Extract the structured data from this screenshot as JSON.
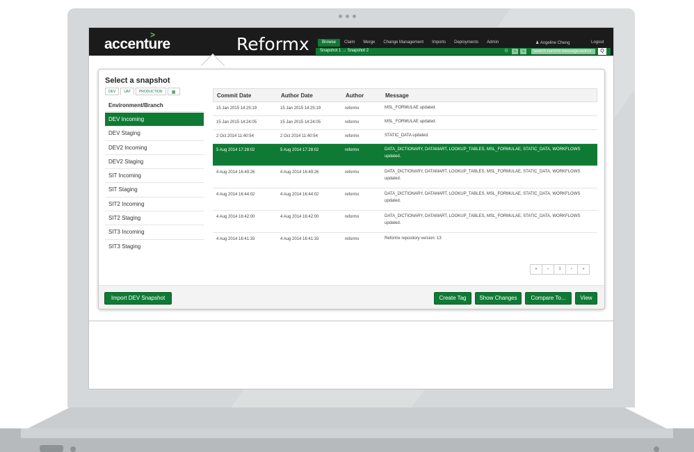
{
  "app": {
    "company": "accenture",
    "company_mark": ">",
    "product": "Reformx"
  },
  "nav": {
    "items": [
      "Browse",
      "Claim",
      "Merge",
      "Change Management",
      "Imports",
      "Deployments",
      "Admin"
    ],
    "user": "Angeline Cheng",
    "logout": "Logout"
  },
  "breadcrumb": {
    "text": "Snapshot 1 → Snapshot 2"
  },
  "search": {
    "placeholder": "Search commit message/author",
    "prev": "«",
    "next": "»",
    "go": "Q"
  },
  "panel": {
    "title": "Select a snapshot",
    "env_tabs": [
      "DEV",
      "UAT",
      "PRODUCTION"
    ],
    "table_icon": "table-icon"
  },
  "branches": {
    "header": "Environment/Branch",
    "items": [
      "DEV Incoming",
      "DEV Staging",
      "DEV2 Incoming",
      "DEV2 Staging",
      "SIT Incoming",
      "SIT Staging",
      "SIT2 Incoming",
      "SIT2 Staging",
      "SIT3 Incoming",
      "SIT3 Staging"
    ]
  },
  "commits": {
    "headers": [
      "Commit Date",
      "Author Date",
      "Author",
      "Message"
    ],
    "rows": [
      {
        "commit": "15 Jan 2015 14:25:19",
        "author_date": "15 Jan 2015 14:25:19",
        "author": "reformx",
        "message": "MSL_FORMULAE updated."
      },
      {
        "commit": "15 Jan 2015 14:24:05",
        "author_date": "15 Jan 2015 14:24:05",
        "author": "reformx",
        "message": "MSL_FORMULAE updated."
      },
      {
        "commit": "2 Oct 2014 11:40:54",
        "author_date": "2 Oct 2014 11:40:54",
        "author": "reformx",
        "message": "STATIC_DATA updated."
      },
      {
        "commit": "5 Aug 2014 17:28:02",
        "author_date": "5 Aug 2014 17:28:02",
        "author": "reformx",
        "message": "DATA_DICTIONARY, DATAMART, LOOKUP_TABLES, MSL_FORMULAE, STATIC_DATA, WORKFLOWS updated."
      },
      {
        "commit": "4 Aug 2014 16:49:26",
        "author_date": "4 Aug 2014 16:49:26",
        "author": "reformx",
        "message": "DATA_DICTIONARY, DATAMART, LOOKUP_TABLES, MSL_FORMULAE, STATIC_DATA, WORKFLOWS updated."
      },
      {
        "commit": "4 Aug 2014 16:44:02",
        "author_date": "4 Aug 2014 16:44:02",
        "author": "reformx",
        "message": "DATA_DICTIONARY, DATAMART, LOOKUP_TABLES, MSL_FORMULAE, STATIC_DATA, WORKFLOWS updated."
      },
      {
        "commit": "4 Aug 2014 16:42:00",
        "author_date": "4 Aug 2014 16:42:00",
        "author": "reformx",
        "message": "DATA_DICTIONARY, DATAMART, LOOKUP_TABLES, MSL_FORMULAE, STATIC_DATA, WORKFLOWS updated."
      },
      {
        "commit": "4 Aug 2014 16:41:33",
        "author_date": "4 Aug 2014 16:41:33",
        "author": "reformx",
        "message": "Reformx repository version: 13"
      }
    ]
  },
  "pager": {
    "first": "«",
    "prev": "‹",
    "page": "1",
    "next": "›",
    "last": "»"
  },
  "footer": {
    "import": "Import DEV Snapshot",
    "create_tag": "Create Tag",
    "show_changes": "Show Changes",
    "compare": "Compare To...",
    "view": "View"
  },
  "colors": {
    "accent": "#0f7a34",
    "header_bg": "#1b1b1b"
  }
}
